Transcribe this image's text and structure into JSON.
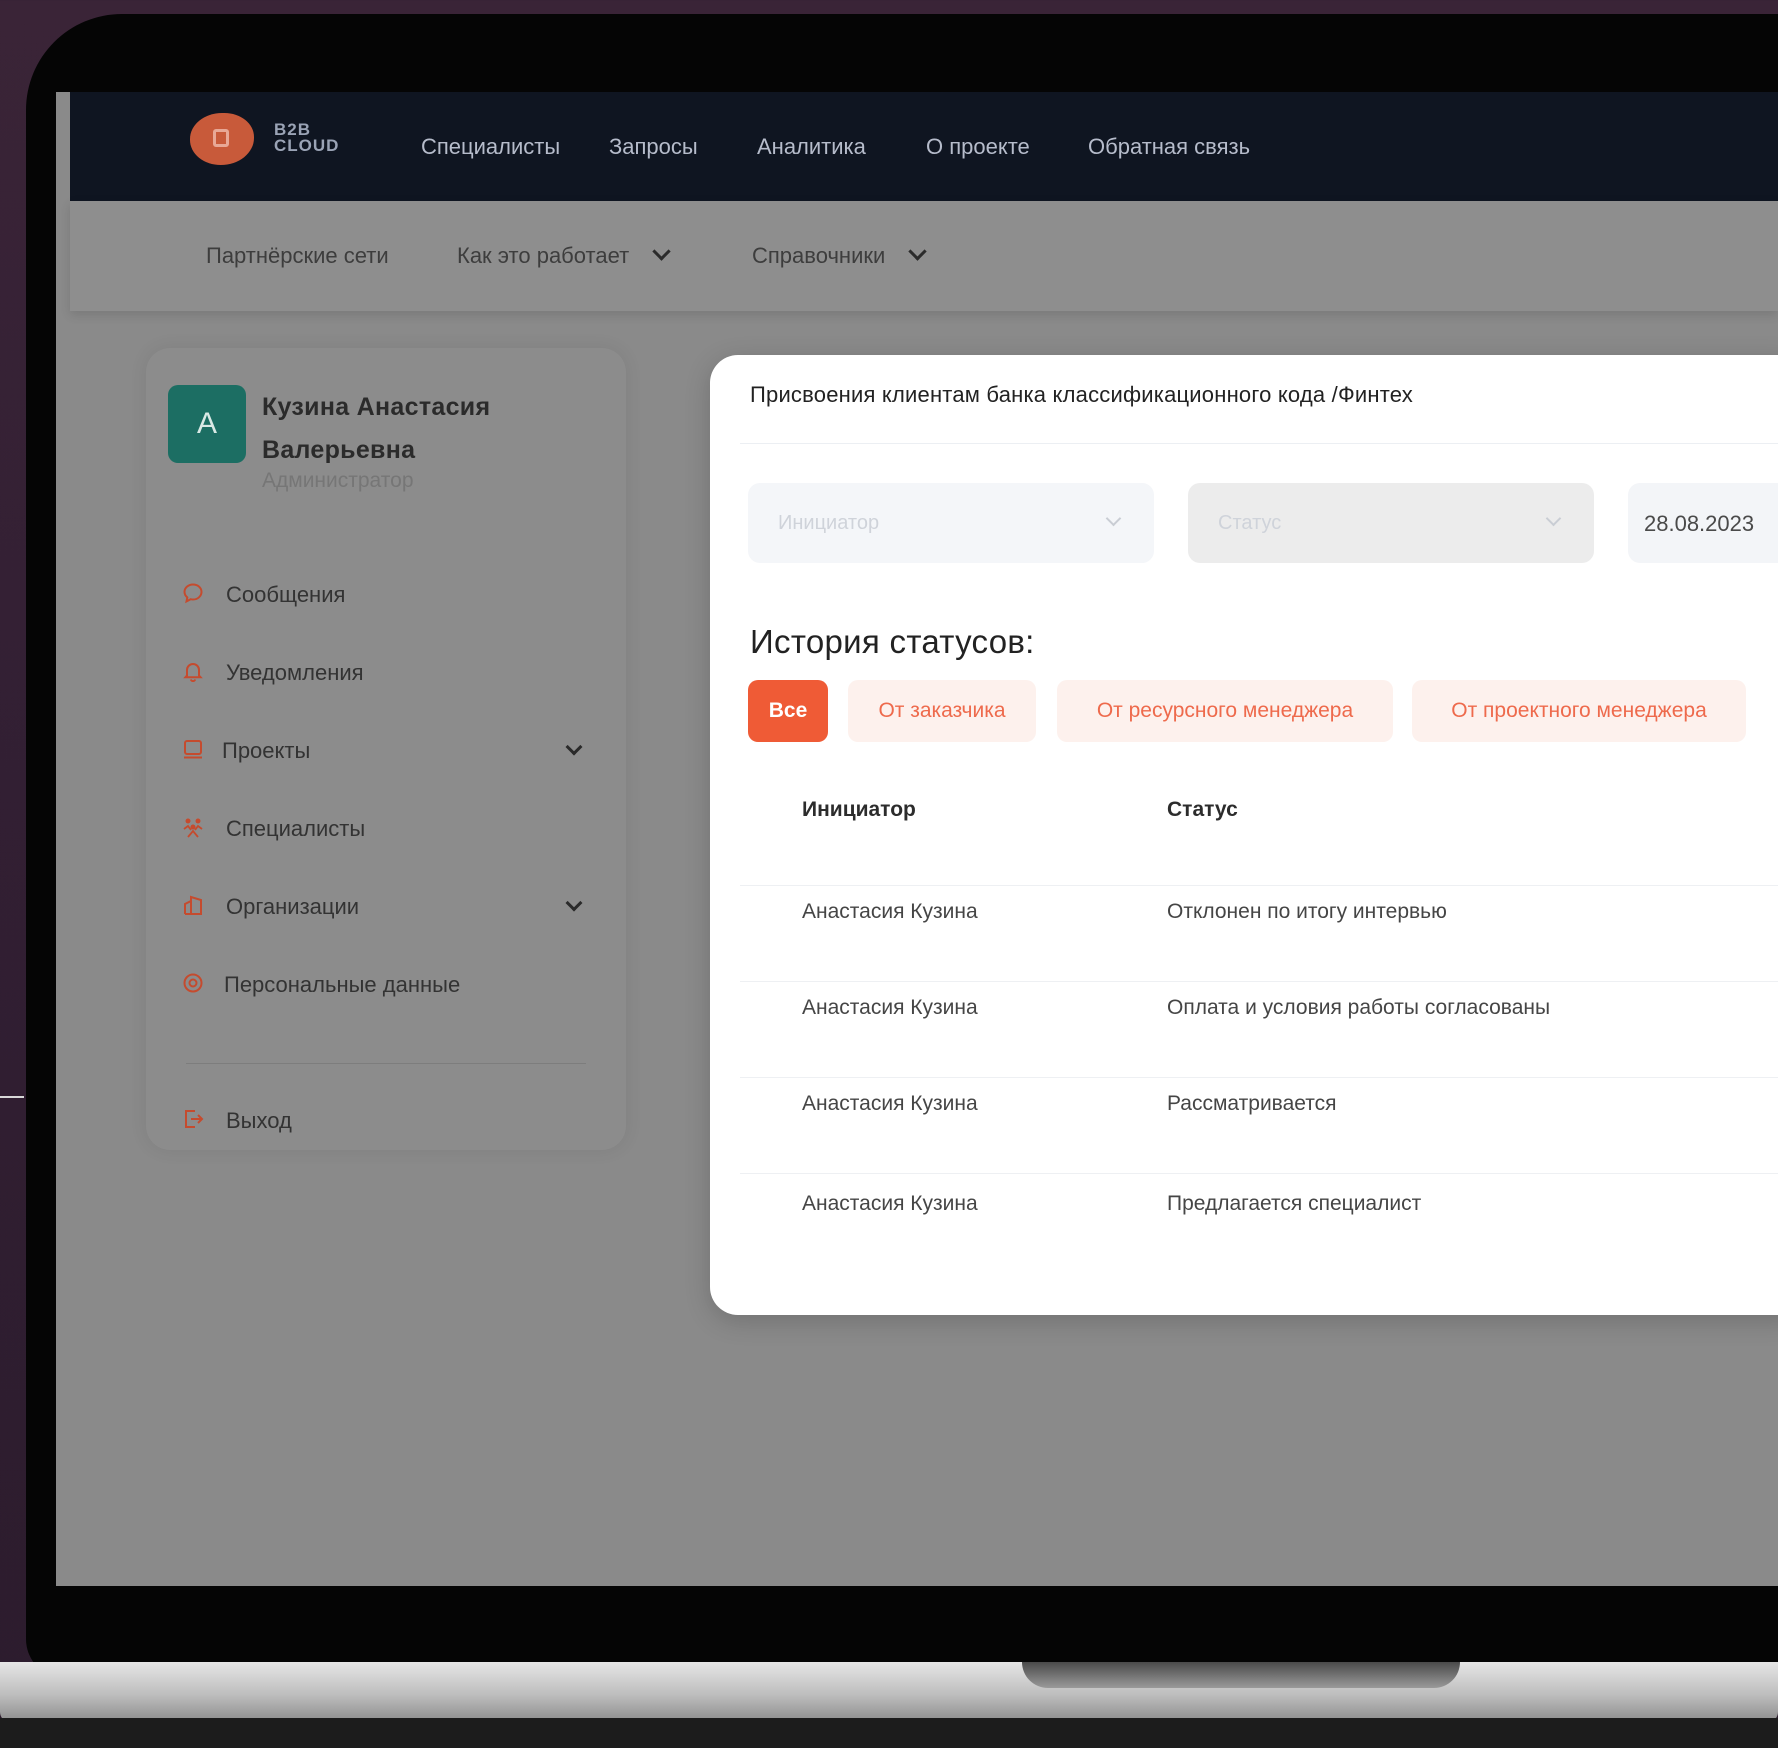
{
  "app": {
    "logo_line1": "B2B",
    "logo_line2": "CLOUD"
  },
  "topnav": [
    "Специалисты",
    "Запросы",
    "Аналитика",
    "О проекте",
    "Обратная связь"
  ],
  "subnav": [
    "Партнёрские сети",
    "Как это работает",
    "Справочники"
  ],
  "user": {
    "initial": "A",
    "name": "Кузина Анастасия Валерьевна",
    "role": "Администратор"
  },
  "sidebar": {
    "items": [
      {
        "label": "Сообщения",
        "icon": "chat-bubble-icon"
      },
      {
        "label": "Уведомления",
        "icon": "bell-icon"
      },
      {
        "label": "Проекты",
        "icon": "folder-icon"
      },
      {
        "label": "Специалисты",
        "icon": "people-icon"
      },
      {
        "label": "Организации",
        "icon": "buildings-icon"
      },
      {
        "label": "Персональные данные",
        "icon": "gear-icon"
      }
    ],
    "logout": "Выход"
  },
  "card": {
    "title": "Присвоения клиентам банка классификационного кода /Финтех",
    "initiator_placeholder": "Инициатор",
    "status_placeholder": "Статус",
    "date": "28.08.2023",
    "history_title": "История статусов:",
    "filters": [
      "Все",
      "От заказчика",
      "От ресурсного менеджера",
      "От проектного менеджера"
    ],
    "active_filter": "Все",
    "table": {
      "headers": [
        "Инициатор",
        "Статус"
      ],
      "rows": [
        [
          "Анастасия Кузина",
          "Отклонен по итогу интервью"
        ],
        [
          "Анастасия Кузина",
          "Оплата и условия работы согласованы"
        ],
        [
          "Анастасия Кузина",
          "Рассматривается"
        ],
        [
          "Анастасия Кузина",
          "Предлагается специалист"
        ]
      ]
    }
  },
  "colors": {
    "accent": "#ef5b36",
    "nav_bg": "#0f1521",
    "avatar": "#1c6e63",
    "chip_bg": "#fdf1ed"
  }
}
